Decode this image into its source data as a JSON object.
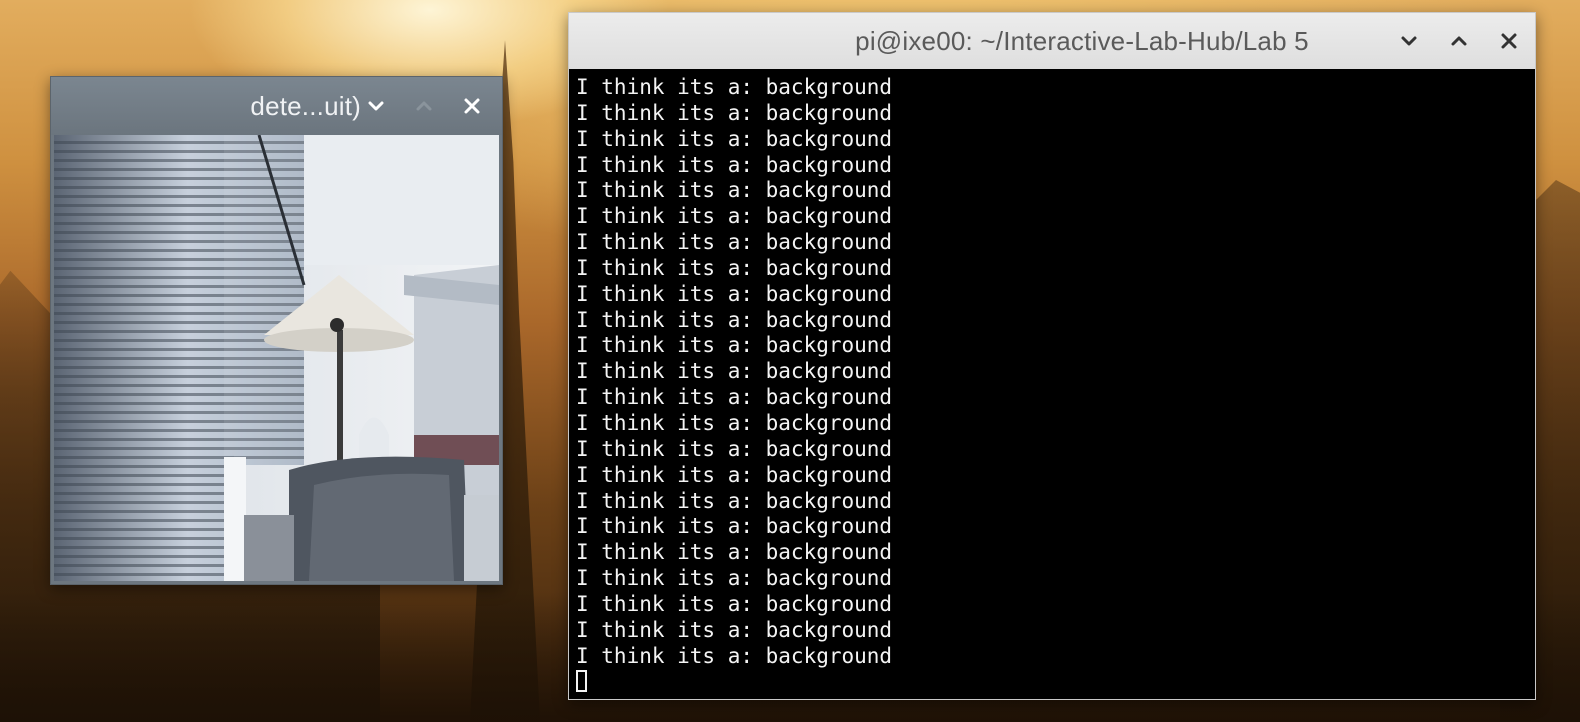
{
  "desktop": {
    "wallpaper": "sunset-mountain-wallpaper"
  },
  "camera_window": {
    "title": "dete...uit)",
    "controls": [
      "chevron-down-icon",
      "chevron-up-icon",
      "close-icon"
    ],
    "feed": "webcam-frame-room-with-blinds-and-lamp"
  },
  "terminal_window": {
    "title": "pi@ixe00: ~/Interactive-Lab-Hub/Lab 5",
    "controls": [
      "chevron-down-icon",
      "chevron-up-icon",
      "close-icon"
    ],
    "lines": [
      "I think its a: background",
      "I think its a: background",
      "I think its a: background",
      "I think its a: background",
      "I think its a: background",
      "I think its a: background",
      "I think its a: background",
      "I think its a: background",
      "I think its a: background",
      "I think its a: background",
      "I think its a: background",
      "I think its a: background",
      "I think its a: background",
      "I think its a: background",
      "I think its a: background",
      "I think its a: background",
      "I think its a: background",
      "I think its a: background",
      "I think its a: background",
      "I think its a: background",
      "I think its a: background",
      "I think its a: background",
      "I think its a: background"
    ]
  },
  "colors": {
    "dark_titlebar": "#6b757e",
    "light_titlebar": "#e4e4e4",
    "terminal_bg": "#000000",
    "terminal_fg": "#f4f4f4"
  }
}
